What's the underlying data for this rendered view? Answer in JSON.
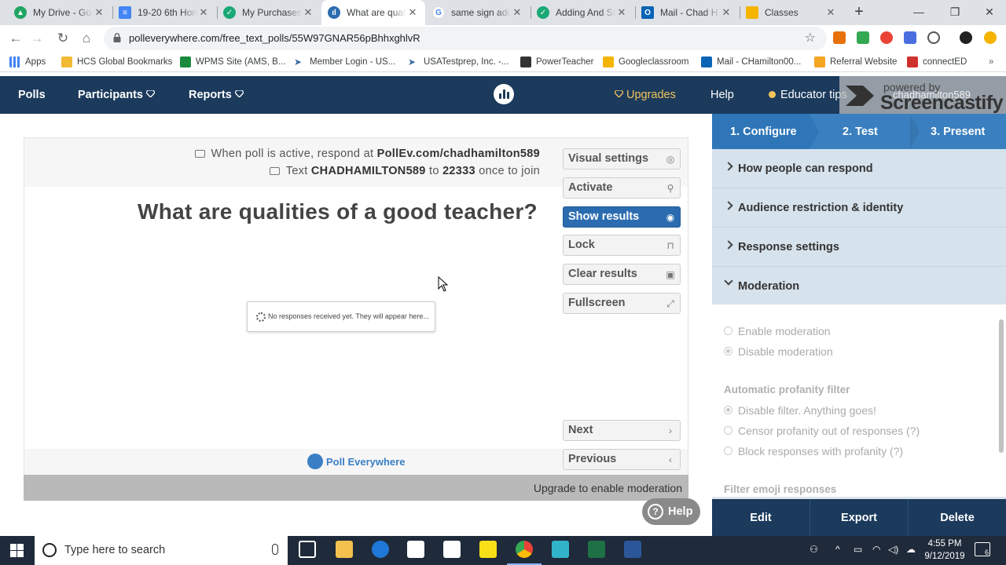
{
  "browser": {
    "tabs": [
      {
        "label": "My Drive - Go",
        "icon": "google-drive-icon",
        "color": "#1fa463"
      },
      {
        "label": "19-20 6th Hon",
        "icon": "google-docs-icon",
        "color": "#4285f4"
      },
      {
        "label": "My Purchases",
        "icon": "tpt-icon",
        "color": "#19a974"
      },
      {
        "label": "What are quali",
        "icon": "polleverywhere-icon",
        "color": "#2b6cb0"
      },
      {
        "label": "same sign add",
        "icon": "google-icon",
        "color": "#4285f4"
      },
      {
        "label": "Adding And Su",
        "icon": "tpt-icon",
        "color": "#19a974"
      },
      {
        "label": "Mail - Chad H",
        "icon": "outlook-icon",
        "color": "#0a64b5"
      },
      {
        "label": "Classes",
        "icon": "classroom-icon",
        "color": "#f4b400"
      }
    ],
    "url": "polleverywhere.com/free_text_polls/55W97GNAR56pBhhxghlvR",
    "bookmarks": [
      {
        "label": "Apps",
        "icon": "apps-grid-icon"
      },
      {
        "label": "HCS Global Bookmarks",
        "icon": "folder-icon"
      },
      {
        "label": "WPMS Site (AMS, B...",
        "icon": "wpms-icon"
      },
      {
        "label": "Member Login - US...",
        "icon": "cursor-icon"
      },
      {
        "label": "USATestprep, Inc. -...",
        "icon": "cursor-icon"
      },
      {
        "label": "PowerTeacher",
        "icon": "powerteacher-icon"
      },
      {
        "label": "Googleclassroom",
        "icon": "classroom-icon"
      },
      {
        "label": "Mail - CHamilton00...",
        "icon": "outlook-icon"
      },
      {
        "label": "Referral Website",
        "icon": "referral-icon"
      },
      {
        "label": "connectED",
        "icon": "connected-icon"
      }
    ]
  },
  "app": {
    "nav": {
      "polls": "Polls",
      "participants": "Participants",
      "reports": "Reports",
      "upgrades": "Upgrades",
      "help": "Help",
      "educator_tips": "Educator tips",
      "username": "chadhamilton589"
    },
    "watermark": {
      "line1": "powered by",
      "line2": "Screencastify"
    },
    "poll": {
      "instruction_web_prefix": "When poll is active, respond at",
      "instruction_web_url": "PollEv.com/chadhamilton589",
      "instruction_text_prefix": "Text",
      "instruction_text_code": "CHADHAMILTON589",
      "instruction_text_mid": "to",
      "instruction_text_number": "22333",
      "instruction_text_suffix": "once to join",
      "question": "What are qualities of a good teacher?",
      "no_responses": "No responses received yet. They will appear here...",
      "brand": "Poll Everywhere",
      "upgrade_note": "Upgrade to enable moderation"
    },
    "actions": {
      "visual_settings": "Visual settings",
      "activate": "Activate",
      "show_results": "Show results",
      "lock": "Lock",
      "clear_results": "Clear results",
      "fullscreen": "Fullscreen",
      "next": "Next",
      "previous": "Previous"
    },
    "help_button": "Help",
    "panel": {
      "steps": [
        "1. Configure",
        "2. Test",
        "3. Present"
      ],
      "sections": [
        "How people can respond",
        "Audience restriction & identity",
        "Response settings",
        "Moderation"
      ],
      "moderation_options": [
        "Enable moderation",
        "Disable moderation"
      ],
      "moderation_selected": "Disable moderation",
      "profanity_heading": "Automatic profanity filter",
      "profanity_options": [
        "Disable filter. Anything goes!",
        "Censor profanity out of responses (?)",
        "Block responses with profanity (?)"
      ],
      "profanity_selected": "Disable filter. Anything goes!",
      "emoji_heading": "Filter emoji responses",
      "footer": {
        "edit": "Edit",
        "export": "Export",
        "delete": "Delete"
      }
    }
  },
  "taskbar": {
    "search_placeholder": "Type here to search",
    "time": "4:55 PM",
    "date": "9/12/2019",
    "notification_count": "6"
  },
  "colors": {
    "nav_bg": "#1b3a5c",
    "accent_blue": "#2b6cb0",
    "panel_bg": "#dde6ee",
    "upgrade_gold": "#f3c55a"
  }
}
